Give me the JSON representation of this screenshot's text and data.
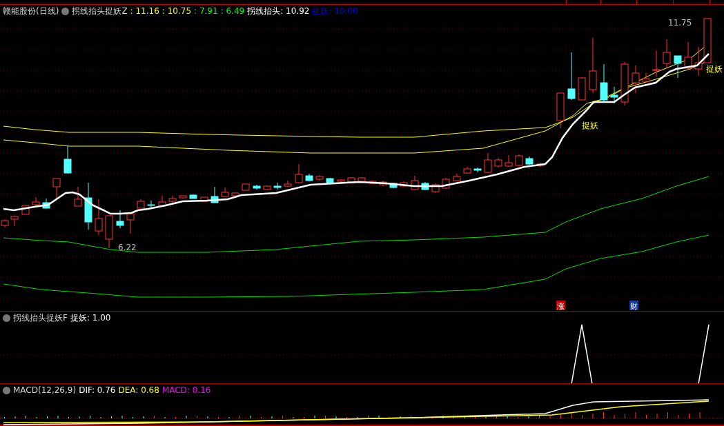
{
  "main_panel": {
    "stock": "赣能股份(日线)",
    "indicator": "拐线抬头捉妖Z",
    "values": [
      {
        "text": ": 11.16",
        "color": "#ffff00"
      },
      {
        "text": ": 10.75",
        "color": "#ffff00"
      },
      {
        "text": ": 7.91",
        "color": "#00ff00"
      },
      {
        "text": ": 6.49",
        "color": "#00ff00"
      }
    ],
    "readouts": [
      {
        "label": "拐线抬头:",
        "value": "10.92",
        "color": "#ffffff"
      },
      {
        "label": "捉妖:",
        "value": "10.00",
        "color": "#0000ff"
      }
    ],
    "high_label": "11.75",
    "low_label": "6.22",
    "signals": [
      "捉妖",
      "捉妖"
    ],
    "event_markers": [
      {
        "text": "涨",
        "color": "#c00000"
      },
      {
        "text": "财",
        "color": "#1a3a9a"
      }
    ]
  },
  "signal_panel": {
    "indicator": "拐线抬头捉妖F",
    "readouts": [
      {
        "label": "捉妖:",
        "value": "1.00",
        "color": "#ffffff"
      }
    ]
  },
  "macd_panel": {
    "indicator": "MACD(12,26,9)",
    "readouts": [
      {
        "label": "DIF:",
        "value": "0.76",
        "color": "#ffffff"
      },
      {
        "label": "DEA:",
        "value": "0.68",
        "color": "#ffff00"
      },
      {
        "label": "MACD:",
        "value": "0.16",
        "color": "#ff00ff"
      }
    ]
  }
}
